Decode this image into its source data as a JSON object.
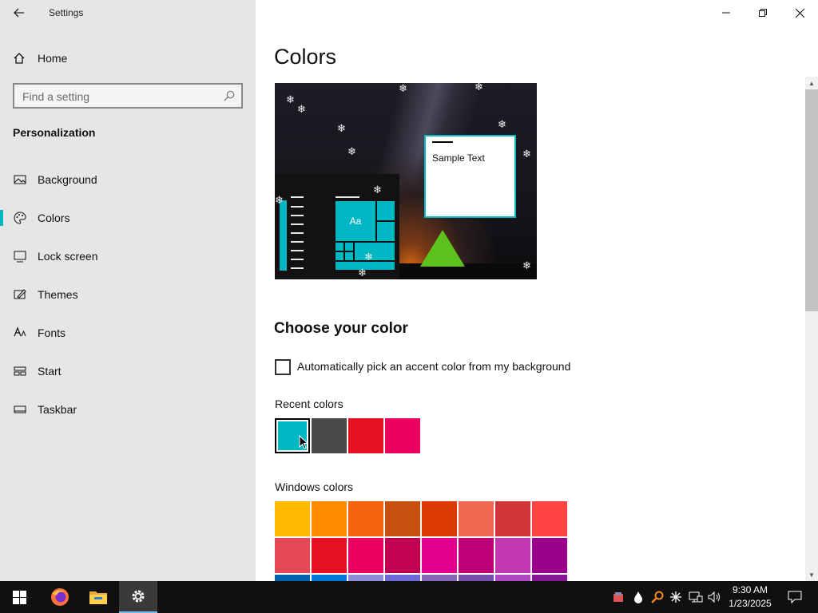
{
  "window": {
    "title": "Settings"
  },
  "sidebar": {
    "home_label": "Home",
    "search_placeholder": "Find a setting",
    "section_title": "Personalization",
    "items": [
      {
        "label": "Background",
        "icon": "image-icon"
      },
      {
        "label": "Colors",
        "icon": "palette-icon"
      },
      {
        "label": "Lock screen",
        "icon": "lock-screen-icon"
      },
      {
        "label": "Themes",
        "icon": "themes-icon"
      },
      {
        "label": "Fonts",
        "icon": "fonts-icon"
      },
      {
        "label": "Start",
        "icon": "start-icon"
      },
      {
        "label": "Taskbar",
        "icon": "taskbar-icon"
      }
    ],
    "selected": "Colors"
  },
  "main": {
    "title": "Colors",
    "preview": {
      "sample_text": "Sample Text",
      "tile_text": "Aa"
    },
    "choose_heading": "Choose your color",
    "auto_pick_label": "Automatically pick an accent color from my background",
    "auto_pick_checked": false,
    "recent_label": "Recent colors",
    "recent_colors": [
      "#00b7c3",
      "#4c4a48",
      "#e81123",
      "#ea005e"
    ],
    "recent_selected": "#00b7c3",
    "windows_label": "Windows colors",
    "windows_colors": [
      [
        "#ffb900",
        "#ff8c00",
        "#f7630c",
        "#ca5010",
        "#da3b01",
        "#ef6950",
        "#d13438",
        "#ff4343"
      ],
      [
        "#e74856",
        "#e81123",
        "#ea005e",
        "#c30052",
        "#e3008c",
        "#bf0077",
        "#c239b3",
        "#9a0089"
      ],
      [
        "#0063b1",
        "#0078d7",
        "#8e8cd8",
        "#6b69d6",
        "#8764b8",
        "#744da9",
        "#b146c2",
        "#881798"
      ]
    ]
  },
  "accent_color": "#00b7c3",
  "taskbar": {
    "time": "9:30 AM",
    "date": "1/23/2025",
    "pinned": [
      "firefox-icon",
      "file-explorer-icon",
      "settings-icon"
    ]
  }
}
